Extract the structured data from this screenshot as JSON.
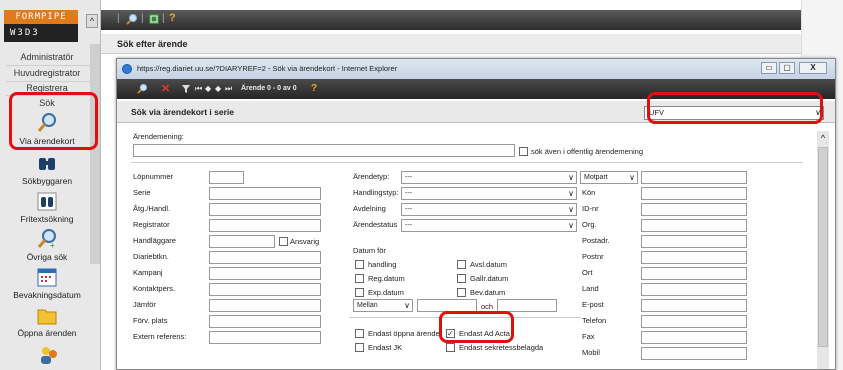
{
  "logo": {
    "top": "FORMPIPE",
    "bottom": "W3D3"
  },
  "sidebar": {
    "collapse": "^",
    "links": [
      "Administratör",
      "Huvudregistrator",
      "Registrera",
      "Sök"
    ],
    "tools": [
      {
        "label": "Via ärendekort",
        "icon": "magnifier-icon"
      },
      {
        "label": "Sökbyggaren",
        "icon": "binoculars-icon"
      },
      {
        "label": "Fritextsökning",
        "icon": "binoculars-text-icon"
      },
      {
        "label": "Övriga sök",
        "icon": "magnifier-plus-icon"
      },
      {
        "label": "Bevakningsdatum",
        "icon": "calendar-icon"
      },
      {
        "label": "Öppna ärenden",
        "icon": "folder-icon"
      }
    ]
  },
  "toolbar": {
    "sep": "|",
    "help": "?"
  },
  "page_heading": "Sök efter ärende",
  "ie": {
    "title": "https://reg.diariet.uu.se/?DIARYREF=2 - Sök via ärendekort - Internet Explorer",
    "min": "▭",
    "max": "▢",
    "close": "X"
  },
  "dlg_toolbar": {
    "label": "Ärende 0 - 0 av 0",
    "help": "?",
    "x": "✕"
  },
  "dialog_header": "Sök via ärendekort i serie",
  "series": {
    "value": "UFV",
    "chevron": "∨"
  },
  "arendemening": {
    "label": "Ärendemening:",
    "public_label": "sök även i offentlig ärendemening"
  },
  "left_fields": [
    "Löpnummer",
    "Serie",
    "Åtg./Handl.",
    "Registrator",
    "Handläggare",
    "Diariebtkn.",
    "Kampanj",
    "Kontaktpers.",
    "Jämför",
    "Förv. plats",
    "Extern referens:"
  ],
  "ansvarig": "Ansvarig",
  "mid_fields": [
    {
      "label": "Ärendetyp:",
      "value": "---"
    },
    {
      "label": "Handlingstyp:",
      "value": "---"
    },
    {
      "label": "Avdelning",
      "value": "---"
    },
    {
      "label": "Ärendestatus",
      "value": "---"
    }
  ],
  "dates": {
    "title": "Datum för",
    "items": [
      "handling",
      "Avsl.datum",
      "Reg.datum",
      "Gallr.datum",
      "Exp.datum",
      "Bev.datum"
    ],
    "range": "Mellan",
    "och": "och"
  },
  "flags": {
    "open": "Endast öppna ärende",
    "adacta": "Endast Ad Acta",
    "jk": "Endast JK",
    "sekretess": "Endast sekretessbelagda"
  },
  "motpart": {
    "select": "Motpart",
    "fields": [
      "Kön",
      "ID-nr",
      "Org.",
      "Postadr.",
      "Postnr",
      "Ort",
      "Land",
      "E-post",
      "Telefon",
      "Fax",
      "Mobil"
    ]
  },
  "colors": {
    "accent": "#e07a1a",
    "highlight": "#e01010"
  }
}
